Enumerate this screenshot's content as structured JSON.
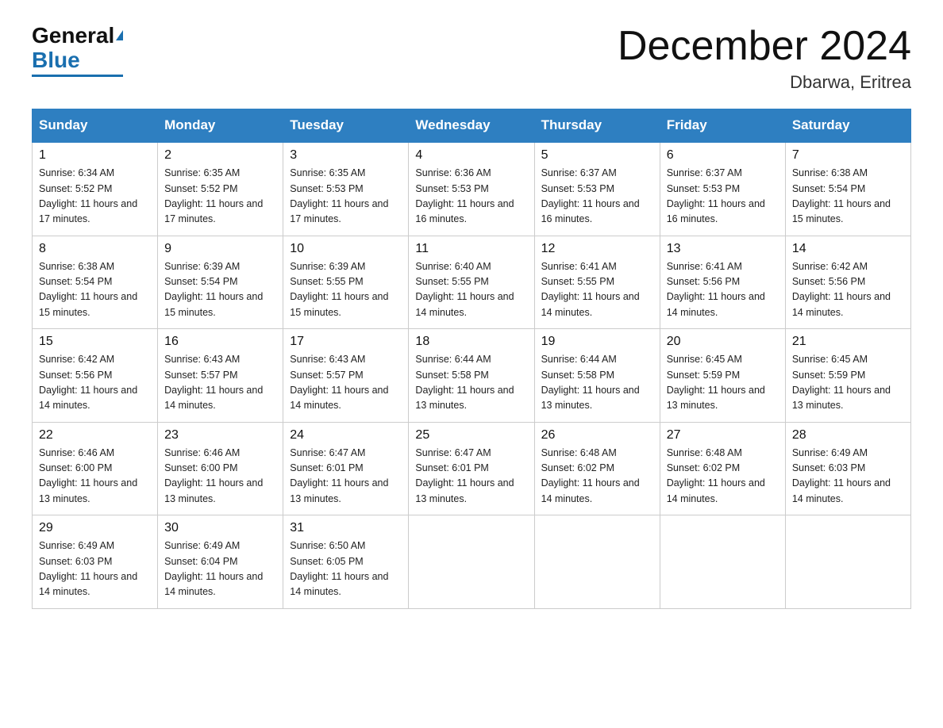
{
  "logo": {
    "line1": "General",
    "line2": "Blue"
  },
  "title": "December 2024",
  "subtitle": "Dbarwa, Eritrea",
  "weekdays": [
    "Sunday",
    "Monday",
    "Tuesday",
    "Wednesday",
    "Thursday",
    "Friday",
    "Saturday"
  ],
  "weeks": [
    [
      {
        "day": "1",
        "sunrise": "6:34 AM",
        "sunset": "5:52 PM",
        "daylight": "11 hours and 17 minutes."
      },
      {
        "day": "2",
        "sunrise": "6:35 AM",
        "sunset": "5:52 PM",
        "daylight": "11 hours and 17 minutes."
      },
      {
        "day": "3",
        "sunrise": "6:35 AM",
        "sunset": "5:53 PM",
        "daylight": "11 hours and 17 minutes."
      },
      {
        "day": "4",
        "sunrise": "6:36 AM",
        "sunset": "5:53 PM",
        "daylight": "11 hours and 16 minutes."
      },
      {
        "day": "5",
        "sunrise": "6:37 AM",
        "sunset": "5:53 PM",
        "daylight": "11 hours and 16 minutes."
      },
      {
        "day": "6",
        "sunrise": "6:37 AM",
        "sunset": "5:53 PM",
        "daylight": "11 hours and 16 minutes."
      },
      {
        "day": "7",
        "sunrise": "6:38 AM",
        "sunset": "5:54 PM",
        "daylight": "11 hours and 15 minutes."
      }
    ],
    [
      {
        "day": "8",
        "sunrise": "6:38 AM",
        "sunset": "5:54 PM",
        "daylight": "11 hours and 15 minutes."
      },
      {
        "day": "9",
        "sunrise": "6:39 AM",
        "sunset": "5:54 PM",
        "daylight": "11 hours and 15 minutes."
      },
      {
        "day": "10",
        "sunrise": "6:39 AM",
        "sunset": "5:55 PM",
        "daylight": "11 hours and 15 minutes."
      },
      {
        "day": "11",
        "sunrise": "6:40 AM",
        "sunset": "5:55 PM",
        "daylight": "11 hours and 14 minutes."
      },
      {
        "day": "12",
        "sunrise": "6:41 AM",
        "sunset": "5:55 PM",
        "daylight": "11 hours and 14 minutes."
      },
      {
        "day": "13",
        "sunrise": "6:41 AM",
        "sunset": "5:56 PM",
        "daylight": "11 hours and 14 minutes."
      },
      {
        "day": "14",
        "sunrise": "6:42 AM",
        "sunset": "5:56 PM",
        "daylight": "11 hours and 14 minutes."
      }
    ],
    [
      {
        "day": "15",
        "sunrise": "6:42 AM",
        "sunset": "5:56 PM",
        "daylight": "11 hours and 14 minutes."
      },
      {
        "day": "16",
        "sunrise": "6:43 AM",
        "sunset": "5:57 PM",
        "daylight": "11 hours and 14 minutes."
      },
      {
        "day": "17",
        "sunrise": "6:43 AM",
        "sunset": "5:57 PM",
        "daylight": "11 hours and 14 minutes."
      },
      {
        "day": "18",
        "sunrise": "6:44 AM",
        "sunset": "5:58 PM",
        "daylight": "11 hours and 13 minutes."
      },
      {
        "day": "19",
        "sunrise": "6:44 AM",
        "sunset": "5:58 PM",
        "daylight": "11 hours and 13 minutes."
      },
      {
        "day": "20",
        "sunrise": "6:45 AM",
        "sunset": "5:59 PM",
        "daylight": "11 hours and 13 minutes."
      },
      {
        "day": "21",
        "sunrise": "6:45 AM",
        "sunset": "5:59 PM",
        "daylight": "11 hours and 13 minutes."
      }
    ],
    [
      {
        "day": "22",
        "sunrise": "6:46 AM",
        "sunset": "6:00 PM",
        "daylight": "11 hours and 13 minutes."
      },
      {
        "day": "23",
        "sunrise": "6:46 AM",
        "sunset": "6:00 PM",
        "daylight": "11 hours and 13 minutes."
      },
      {
        "day": "24",
        "sunrise": "6:47 AM",
        "sunset": "6:01 PM",
        "daylight": "11 hours and 13 minutes."
      },
      {
        "day": "25",
        "sunrise": "6:47 AM",
        "sunset": "6:01 PM",
        "daylight": "11 hours and 13 minutes."
      },
      {
        "day": "26",
        "sunrise": "6:48 AM",
        "sunset": "6:02 PM",
        "daylight": "11 hours and 14 minutes."
      },
      {
        "day": "27",
        "sunrise": "6:48 AM",
        "sunset": "6:02 PM",
        "daylight": "11 hours and 14 minutes."
      },
      {
        "day": "28",
        "sunrise": "6:49 AM",
        "sunset": "6:03 PM",
        "daylight": "11 hours and 14 minutes."
      }
    ],
    [
      {
        "day": "29",
        "sunrise": "6:49 AM",
        "sunset": "6:03 PM",
        "daylight": "11 hours and 14 minutes."
      },
      {
        "day": "30",
        "sunrise": "6:49 AM",
        "sunset": "6:04 PM",
        "daylight": "11 hours and 14 minutes."
      },
      {
        "day": "31",
        "sunrise": "6:50 AM",
        "sunset": "6:05 PM",
        "daylight": "11 hours and 14 minutes."
      },
      null,
      null,
      null,
      null
    ]
  ]
}
